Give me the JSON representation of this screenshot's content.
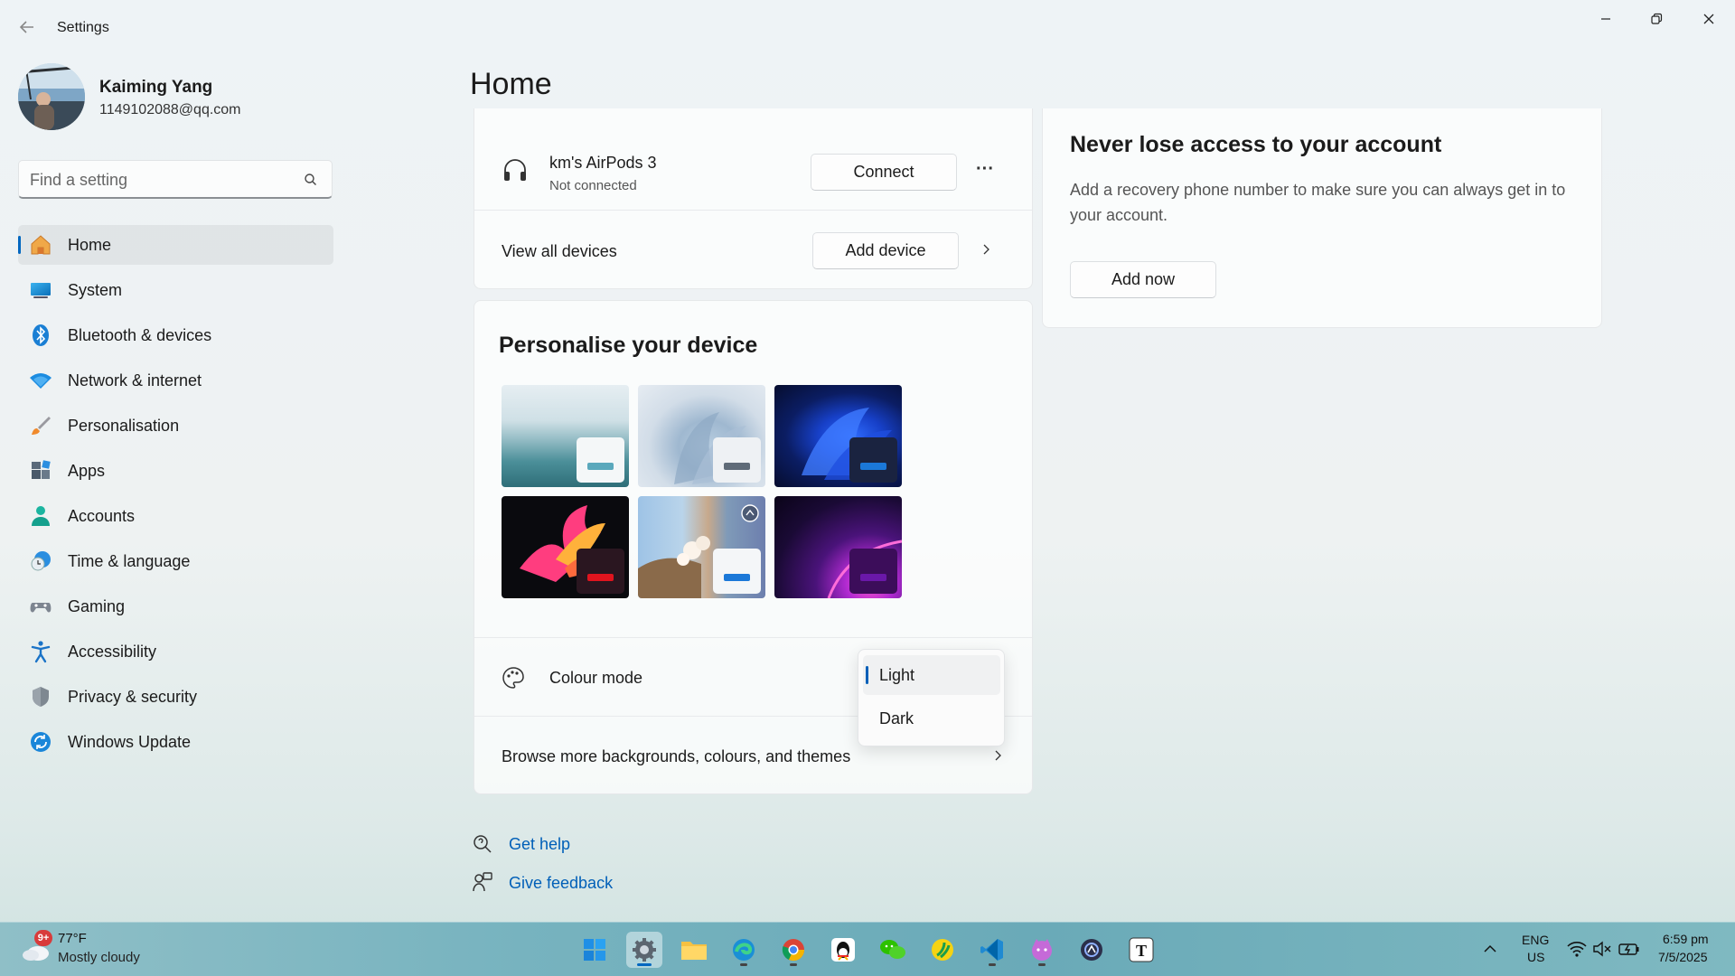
{
  "window": {
    "title": "Settings",
    "back_icon": "back-arrow-icon",
    "controls": [
      "minimize-icon",
      "restore-icon",
      "close-icon"
    ]
  },
  "profile": {
    "name": "Kaiming Yang",
    "email": "1149102088@qq.com"
  },
  "search": {
    "placeholder": "Find a setting",
    "value": ""
  },
  "nav": {
    "items": [
      {
        "label": "Home",
        "icon": "home-icon",
        "selected": true
      },
      {
        "label": "System",
        "icon": "monitor-icon"
      },
      {
        "label": "Bluetooth & devices",
        "icon": "bluetooth-icon"
      },
      {
        "label": "Network & internet",
        "icon": "wifi-icon"
      },
      {
        "label": "Personalisation",
        "icon": "brush-icon"
      },
      {
        "label": "Apps",
        "icon": "apps-icon"
      },
      {
        "label": "Accounts",
        "icon": "person-icon"
      },
      {
        "label": "Time & language",
        "icon": "clock-globe-icon"
      },
      {
        "label": "Gaming",
        "icon": "controller-icon"
      },
      {
        "label": "Accessibility",
        "icon": "accessibility-icon"
      },
      {
        "label": "Privacy & security",
        "icon": "shield-icon"
      },
      {
        "label": "Windows Update",
        "icon": "update-icon"
      }
    ]
  },
  "page": {
    "title": "Home"
  },
  "devices": {
    "device_name": "km's AirPods 3",
    "device_status": "Not connected",
    "connect_label": "Connect",
    "more_label": "···",
    "view_all_label": "View all devices",
    "add_device_label": "Add device"
  },
  "personalise": {
    "title": "Personalise your device",
    "colour_mode_label": "Colour mode",
    "browse_label": "Browse more backgrounds, colours, and themes",
    "themes": [
      "glow-lake",
      "bloom-light",
      "bloom-dark",
      "flow-captured-motion",
      "spotlight-collection",
      "sunrise-purple"
    ]
  },
  "colour_dropdown": {
    "options": [
      "Light",
      "Dark"
    ],
    "selected": "Light"
  },
  "account": {
    "title": "Never lose access to your account",
    "description": "Add a recovery phone number to make sure you can always get in to your account.",
    "button_label": "Add now"
  },
  "help": {
    "get_help": "Get help",
    "give_feedback": "Give feedback"
  },
  "taskbar": {
    "weather_badge": "9+",
    "temperature": "77°F",
    "condition": "Mostly cloudy",
    "lang_top": "ENG",
    "lang_bottom": "US",
    "time": "6:59 pm",
    "date": "7/5/2025",
    "apps": [
      "windows-start-icon",
      "settings-gear-icon",
      "file-explorer-icon",
      "edge-icon",
      "chrome-icon",
      "qq-icon",
      "wechat-icon",
      "sync-app-icon",
      "vscode-icon",
      "cat-app-icon",
      "ai-app-icon",
      "typora-icon"
    ],
    "tray": [
      "chevron-up-icon",
      "wifi-icon",
      "speaker-muted-icon",
      "battery-charging-icon"
    ]
  },
  "colors": {
    "accent": "#005fb8",
    "nav_selection": "#0067c0",
    "text": "#1b1b1b"
  }
}
